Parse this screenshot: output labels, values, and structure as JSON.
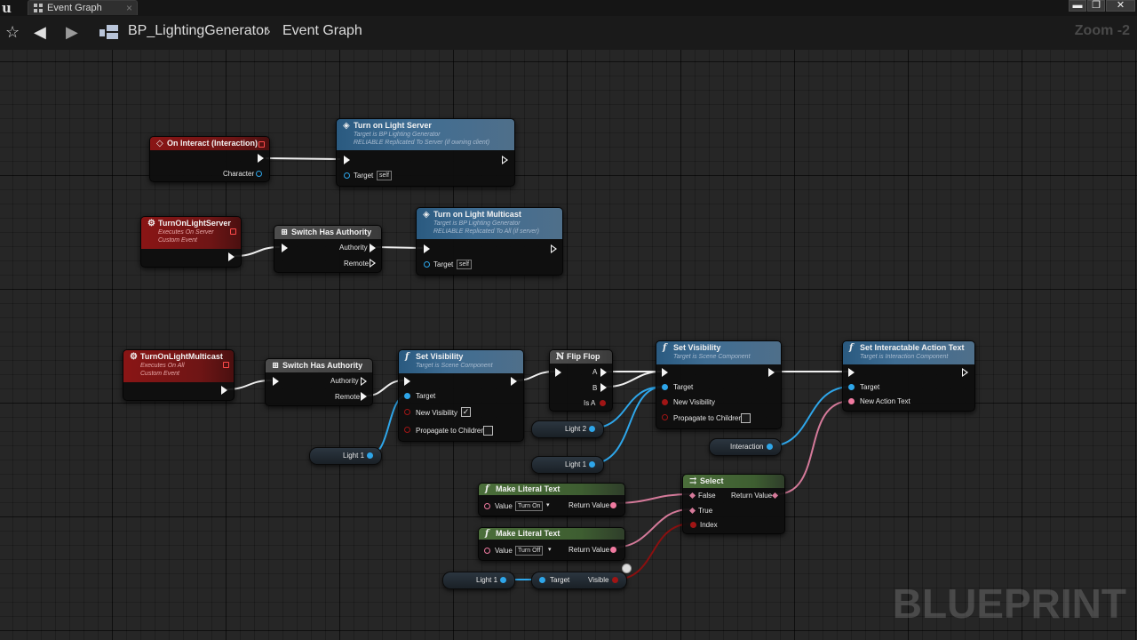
{
  "window": {
    "tab_title": "Event Graph",
    "tab_close": "×",
    "controls": {
      "minimize": "▬",
      "restore": "❐",
      "close": "✕"
    }
  },
  "navbar": {
    "favorite_icon": "star-icon",
    "back_icon": "arrow-left-icon",
    "forward_icon": "arrow-right-icon",
    "breadcrumb": {
      "asset": "BP_LightingGenerator",
      "separator": "›",
      "graph": "Event Graph"
    },
    "zoom": "Zoom -2"
  },
  "watermark": "BLUEPRINT",
  "colors": {
    "exec": "#f5f5f5",
    "object": "#2ea6ea",
    "boolean": "#a01515",
    "text": "#f07aa0",
    "function_header": "#3f6d93",
    "event_header": "#8a1515",
    "pure_header": "#4b6e3a"
  },
  "nodes": {
    "on_interact": {
      "title": "On Interact (Interaction)",
      "out_character": "Character"
    },
    "turn_on_light_server_call": {
      "title": "Turn on Light Server",
      "sub1": "Target is BP Lighting Generator",
      "sub2": "RELIABLE Replicated To Server (if owning client)",
      "target": "Target",
      "target_value": "self"
    },
    "turnonlightserver_event": {
      "title": "TurnOnLightServer",
      "sub1": "Executes On Server",
      "sub2": "Custom Event"
    },
    "switch_authority_1": {
      "title": "Switch Has Authority",
      "authority": "Authority",
      "remote": "Remote"
    },
    "turn_on_light_multicast_call": {
      "title": "Turn on Light Multicast",
      "sub1": "Target is BP Lighting Generator",
      "sub2": "RELIABLE Replicated To All (if server)",
      "target": "Target",
      "target_value": "self"
    },
    "turnonlightmulticast_event": {
      "title": "TurnOnLightMulticast",
      "sub1": "Executes On All",
      "sub2": "Custom Event"
    },
    "switch_authority_2": {
      "title": "Switch Has Authority",
      "authority": "Authority",
      "remote": "Remote"
    },
    "set_visibility_1": {
      "title": "Set Visibility",
      "sub1": "Target is Scene Component",
      "target": "Target",
      "new_visibility": "New Visibility",
      "propagate": "Propagate to Children",
      "new_visibility_checked": true,
      "propagate_checked": false
    },
    "flip_flop": {
      "title": "Flip Flop",
      "a": "A",
      "b": "B",
      "is_a": "Is A"
    },
    "set_visibility_2": {
      "title": "Set Visibility",
      "sub1": "Target is Scene Component",
      "target": "Target",
      "new_visibility": "New Visibility",
      "propagate": "Propagate to Children",
      "propagate_checked": false
    },
    "set_interactable_action_text": {
      "title": "Set Interactable Action Text",
      "sub1": "Target is Interaction Component",
      "target": "Target",
      "new_action_text": "New Action Text"
    },
    "select": {
      "title": "Select",
      "false": "False",
      "true": "True",
      "index": "Index",
      "return_value": "Return Value"
    },
    "make_literal_text_1": {
      "title": "Make Literal Text",
      "value": "Value",
      "value_text": "Turn On",
      "return_value": "Return Value"
    },
    "make_literal_text_2": {
      "title": "Make Literal Text",
      "value": "Value",
      "value_text": "Turn Off",
      "return_value": "Return Value"
    },
    "is_visible": {
      "target": "Target",
      "visible": "Visible"
    }
  },
  "variables": {
    "light1_a": "Light 1",
    "light2": "Light 2",
    "light1_b": "Light 1",
    "interaction": "Interaction",
    "light1_c": "Light 1"
  }
}
